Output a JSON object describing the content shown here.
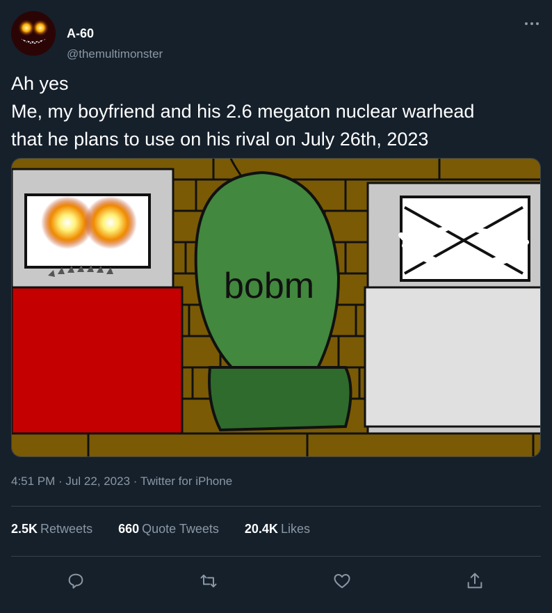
{
  "author": {
    "display_name": "A-60",
    "handle": "@themultimonster"
  },
  "tweet": {
    "lines": [
      "Ah yes",
      "Me, my boyfriend and his 2.6 megaton nuclear warhead",
      "that he plans to use on his rival on July 26th, 2023"
    ],
    "image_text": "bobm"
  },
  "meta": {
    "time": "4:51 PM",
    "separator": " · ",
    "date": "Jul 22, 2023",
    "source": "Twitter for iPhone"
  },
  "stats": {
    "retweets_count": "2.5K",
    "retweets_label": "Retweets",
    "quotes_count": "660",
    "quotes_label": "Quote Tweets",
    "likes_count": "20.4K",
    "likes_label": "Likes"
  },
  "actions": [
    "reply-icon",
    "retweet-icon",
    "like-icon",
    "share-icon"
  ],
  "colors": {
    "background": "#15202b",
    "text": "#ffffff",
    "secondary": "#8b98a5",
    "divider": "#38444d"
  }
}
